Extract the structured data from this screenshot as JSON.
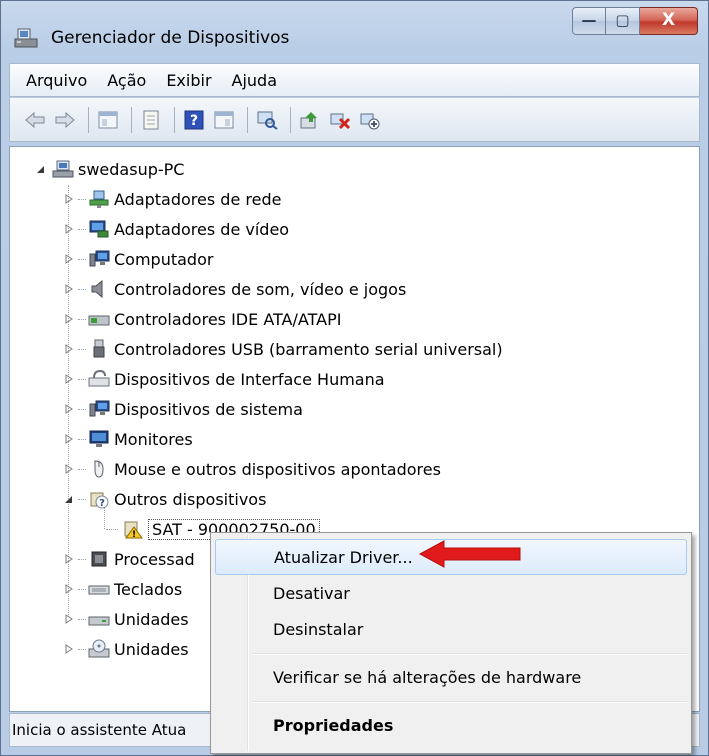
{
  "window": {
    "title": "Gerenciador de Dispositivos",
    "minimize_glyph": "—",
    "maximize_glyph": "▢",
    "close_glyph": "X"
  },
  "menu": {
    "items": [
      "Arquivo",
      "Ação",
      "Exibir",
      "Ajuda"
    ]
  },
  "toolbar": {
    "icons": [
      "back-arrow-icon",
      "forward-arrow-icon",
      "show-hide-tree-icon",
      "properties-icon",
      "help-icon",
      "action-pane-icon",
      "scan-hardware-icon",
      "update-driver-icon",
      "uninstall-device-icon",
      "disable-device-icon"
    ]
  },
  "tree": {
    "root": "swedasup-PC",
    "categories": [
      "Adaptadores de rede",
      "Adaptadores de vídeo",
      "Computador",
      "Controladores de som, vídeo e jogos",
      "Controladores IDE ATA/ATAPI",
      "Controladores USB (barramento serial universal)",
      "Dispositivos de Interface Humana",
      "Dispositivos de sistema",
      "Monitores",
      "Mouse e outros dispositivos apontadores",
      "Outros dispositivos"
    ],
    "selected_device": "SAT - 900002750-00",
    "categories_after": [
      "Processad",
      "Teclados",
      "Unidades",
      "Unidades"
    ]
  },
  "status_bar": {
    "text": "Inicia o assistente Atua"
  },
  "context_menu": {
    "update_driver": "Atualizar Driver...",
    "disable": "Desativar",
    "uninstall": "Desinstalar",
    "scan": "Verificar se há alterações de hardware",
    "properties": "Propriedades"
  },
  "colors": {
    "annotation_arrow": "#e11b1b",
    "highlight_border": "#a8cbf1"
  }
}
